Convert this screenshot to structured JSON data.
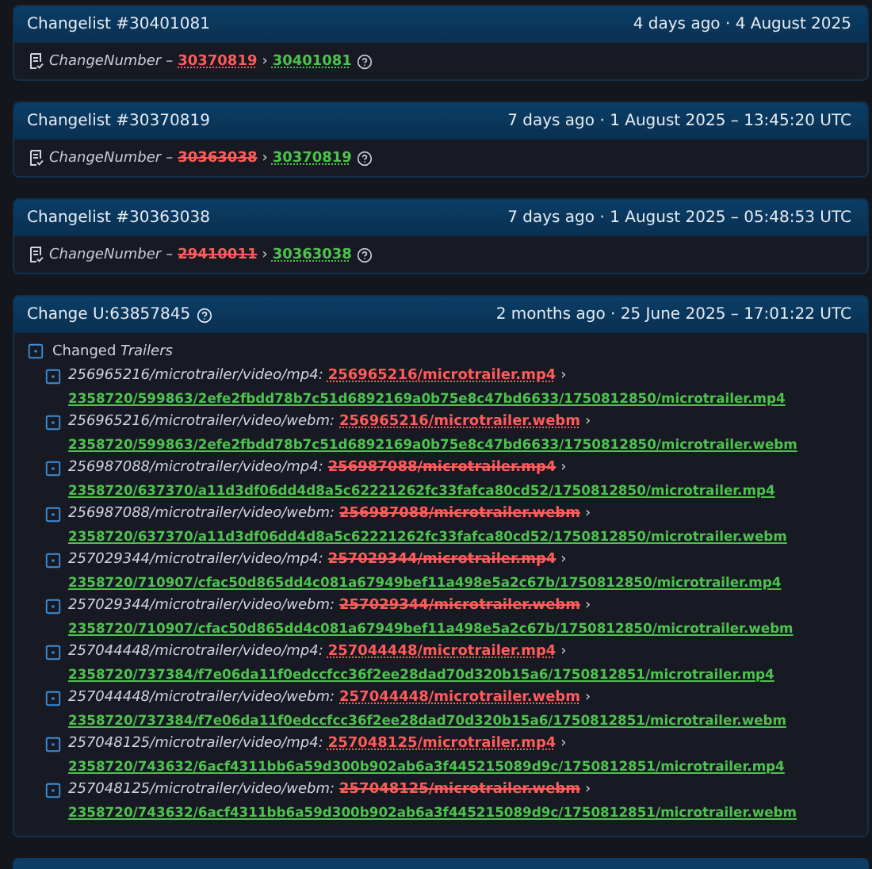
{
  "changelists": [
    {
      "title": "Changelist #30401081",
      "time": "4 days ago · 4 August 2025",
      "field": "ChangeNumber",
      "dash": "–",
      "old": "30370819",
      "arrow": "›",
      "old_struck": false,
      "new": "30401081"
    },
    {
      "title": "Changelist #30370819",
      "time": "7 days ago · 1 August 2025 – 13:45:20 UTC",
      "field": "ChangeNumber",
      "dash": "–",
      "old": "30363038",
      "arrow": "›",
      "old_struck": true,
      "new": "30370819"
    },
    {
      "title": "Changelist #30363038",
      "time": "7 days ago · 1 August 2025 – 05:48:53 UTC",
      "field": "ChangeNumber",
      "dash": "–",
      "old": "29410011",
      "arrow": "›",
      "old_struck": true,
      "new": "30363038"
    }
  ],
  "change": {
    "title": "Change U:63857845",
    "time": "2 months ago · 25 June 2025 – 17:01:22 UTC",
    "group_label": "Changed",
    "group_name": "Trailers",
    "items": [
      {
        "key": "256965216/microtrailer/video/mp4:",
        "old": "256965216/microtrailer.mp4",
        "old_struck": false,
        "arrow": "›",
        "new": "2358720/599863/2efe2fbdd78b7c51d6892169a0b75e8c47bd6633/1750812850/microtrailer.mp4"
      },
      {
        "key": "256965216/microtrailer/video/webm:",
        "old": "256965216/microtrailer.webm",
        "old_struck": false,
        "arrow": "›",
        "new": "2358720/599863/2efe2fbdd78b7c51d6892169a0b75e8c47bd6633/1750812850/microtrailer.webm"
      },
      {
        "key": "256987088/microtrailer/video/mp4:",
        "old": "256987088/microtrailer.mp4",
        "old_struck": true,
        "arrow": "›",
        "new": "2358720/637370/a11d3df06dd4d8a5c62221262fc33fafca80cd52/1750812850/microtrailer.mp4"
      },
      {
        "key": "256987088/microtrailer/video/webm:",
        "old": "256987088/microtrailer.webm",
        "old_struck": true,
        "arrow": "›",
        "new": "2358720/637370/a11d3df06dd4d8a5c62221262fc33fafca80cd52/1750812850/microtrailer.webm"
      },
      {
        "key": "257029344/microtrailer/video/mp4:",
        "old": "257029344/microtrailer.mp4",
        "old_struck": true,
        "arrow": "›",
        "new": "2358720/710907/cfac50d865dd4c081a67949bef11a498e5a2c67b/1750812850/microtrailer.mp4"
      },
      {
        "key": "257029344/microtrailer/video/webm:",
        "old": "257029344/microtrailer.webm",
        "old_struck": true,
        "arrow": "›",
        "new": "2358720/710907/cfac50d865dd4c081a67949bef11a498e5a2c67b/1750812850/microtrailer.webm"
      },
      {
        "key": "257044448/microtrailer/video/mp4:",
        "old": "257044448/microtrailer.mp4",
        "old_struck": false,
        "arrow": "›",
        "new": "2358720/737384/f7e06da11f0edccfcc36f2ee28dad70d320b15a6/1750812851/microtrailer.mp4"
      },
      {
        "key": "257044448/microtrailer/video/webm:",
        "old": "257044448/microtrailer.webm",
        "old_struck": false,
        "arrow": "›",
        "new": "2358720/737384/f7e06da11f0edccfcc36f2ee28dad70d320b15a6/1750812851/microtrailer.webm"
      },
      {
        "key": "257048125/microtrailer/video/mp4:",
        "old": "257048125/microtrailer.mp4",
        "old_struck": false,
        "arrow": "›",
        "new": "2358720/743632/6acf4311bb6a59d300b902ab6a3f445215089d9c/1750812851/microtrailer.mp4"
      },
      {
        "key": "257048125/microtrailer/video/webm:",
        "old": "257048125/microtrailer.webm",
        "old_struck": true,
        "arrow": "›",
        "new": "2358720/743632/6acf4311bb6a59d300b902ab6a3f445215089d9c/1750812851/microtrailer.webm"
      }
    ]
  }
}
